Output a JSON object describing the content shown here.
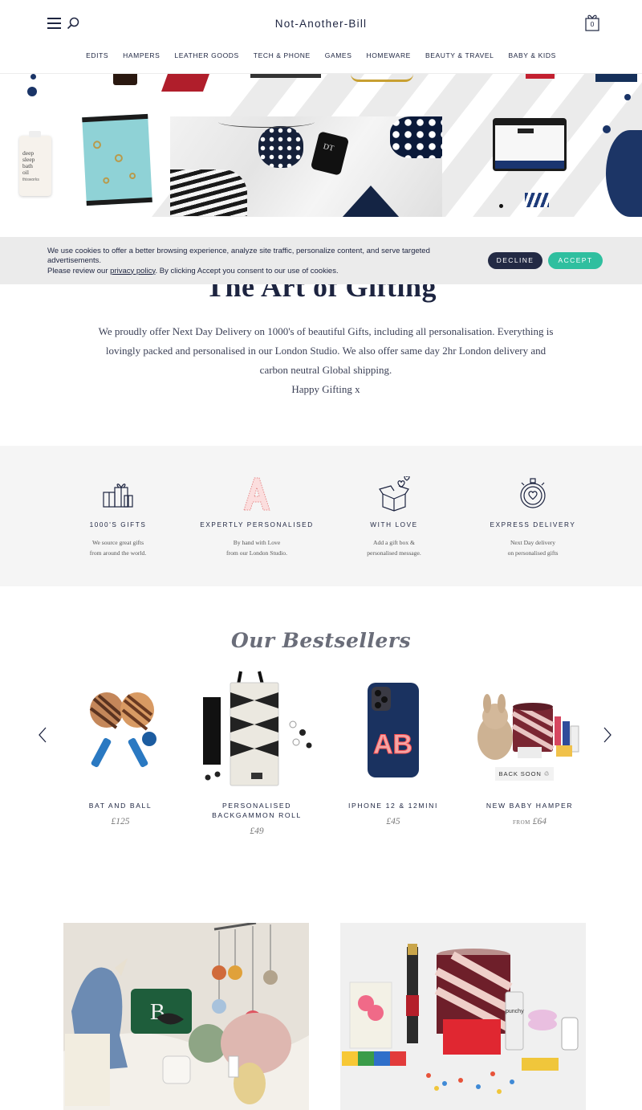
{
  "header": {
    "brand": "Not-Another-Bill",
    "cart_count": "0"
  },
  "nav": [
    {
      "label": "EDITS"
    },
    {
      "label": "HAMPERS"
    },
    {
      "label": "LEATHER GOODS"
    },
    {
      "label": "TECH & PHONE"
    },
    {
      "label": "GAMES"
    },
    {
      "label": "HOMEWARE"
    },
    {
      "label": "BEAUTY & TRAVEL"
    },
    {
      "label": "BABY & KIDS"
    }
  ],
  "hero": {
    "product_text": "deep sleep bath oil",
    "brand_text": "thisworks",
    "monogram": "DT"
  },
  "cookie": {
    "text_1": "We use cookies to offer a better browsing experience, analyze site traffic, personalize content, and serve targeted advertisements.",
    "text_2": "Please review our",
    "link": "privacy policy",
    "text_3": ". By clicking Accept you consent to our use of cookies.",
    "decline": "DECLINE",
    "accept": "ACCEPT"
  },
  "intro": {
    "title": "The Art of Gifting",
    "line_1": "We proudly offer Next Day Delivery on 1000's of beautiful Gifts, including all personalisation. Everything is lovingly packed and personalised in our London Studio. We also offer same day 2hr London delivery and carbon neutral Global shipping.",
    "line_2": "Happy Gifting x"
  },
  "features": [
    {
      "title": "1000'S GIFTS",
      "line1": "We source great gifts",
      "line2": "from around the world.",
      "icon": "gift-boxes-icon"
    },
    {
      "title": "EXPERTLY PERSONALISED",
      "line1": "By hand with Love",
      "line2": "from our London Studio.",
      "icon": "letter-a-icon"
    },
    {
      "title": "WITH LOVE",
      "line1": "Add a gift box &",
      "line2": "personalised message.",
      "icon": "box-hearts-icon"
    },
    {
      "title": "EXPRESS DELIVERY",
      "line1": "Next Day delivery",
      "line2": "on personalised gifts",
      "icon": "stopwatch-heart-icon"
    }
  ],
  "bestsellers": {
    "heading": "Our Bestsellers",
    "products": [
      {
        "name": "BAT AND BALL",
        "price": "£125"
      },
      {
        "name": "PERSONALISED BACKGAMMON ROLL",
        "price": "£49"
      },
      {
        "name": "IPHONE 12 & 12MINI",
        "price": "£45",
        "monogram": "AB"
      },
      {
        "name": "NEW BABY HAMPER",
        "price_prefix": "FROM",
        "price": "£64",
        "badge": "BACK SOON ♲"
      }
    ]
  },
  "tiles": {
    "left_letter": "B",
    "right_brand": "punchy"
  },
  "colors": {
    "navy": "#1d2440",
    "accept": "#2fbf9f",
    "decline": "#232a44",
    "feature_bg": "#f5f5f5",
    "cookie_bg": "#ebebeb"
  }
}
